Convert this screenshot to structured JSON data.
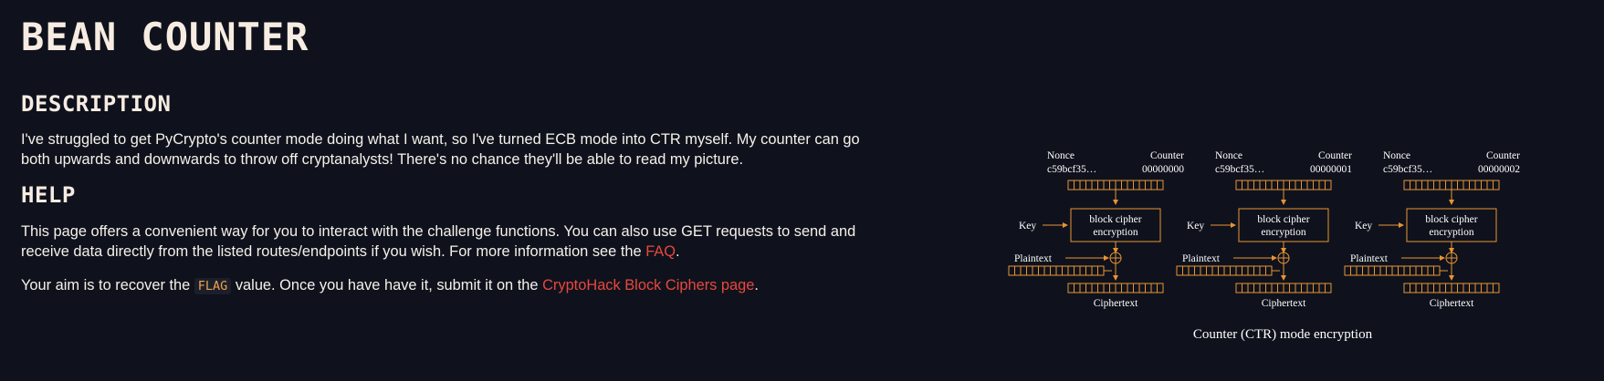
{
  "challenge": {
    "title": "BEAN COUNTER"
  },
  "description": {
    "heading": "DESCRIPTION",
    "text": "I've struggled to get PyCrypto's counter mode doing what I want, so I've turned ECB mode into CTR myself. My counter can go both upwards and downwards to throw off cryptanalysts! There's no chance they'll be able to read my picture."
  },
  "help": {
    "heading": "HELP",
    "para1_text": "This page offers a convenient way for you to interact with the challenge functions. You can also use GET requests to send and receive data directly from the listed routes/endpoints if you wish. For more information see the ",
    "para1_link": "FAQ",
    "para1_end": ".",
    "para2_prefix": "Your aim is to recover the ",
    "para2_code": "FLAG",
    "para2_middle": " value. Once you have have it, submit it on the ",
    "para2_link": "CryptoHack Block Ciphers page",
    "para2_end": "."
  },
  "diagram": {
    "caption": "Counter (CTR) mode encryption",
    "nonce_label": "Nonce",
    "nonce_value": "c59bcf35…",
    "counter_label": "Counter",
    "key_label": "Key",
    "plaintext_label": "Plaintext",
    "ciphertext_label": "Ciphertext",
    "cipher_line1": "block cipher",
    "cipher_line2": "encryption",
    "counters": [
      "00000000",
      "00000001",
      "00000002"
    ],
    "colors": {
      "accent": "#e89433",
      "text": "#ffffff"
    }
  }
}
